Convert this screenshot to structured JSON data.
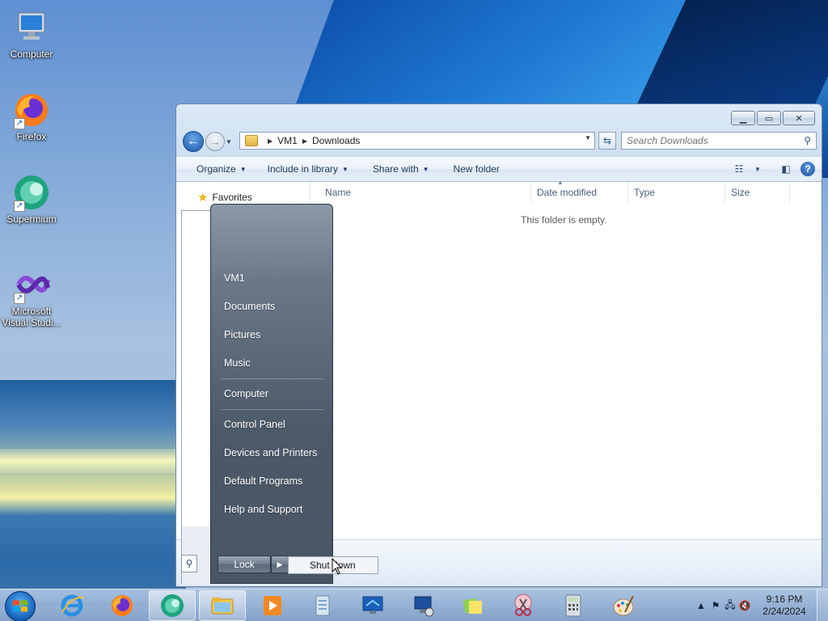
{
  "desktop": {
    "icons": [
      {
        "label": "Computer"
      },
      {
        "label": "Firefox"
      },
      {
        "label": "Supermium"
      },
      {
        "label": "Microsoft Visual Studi..."
      }
    ]
  },
  "explorer": {
    "address": {
      "root": "VM1",
      "current": "Downloads"
    },
    "search_placeholder": "Search Downloads",
    "toolbar": {
      "organize": "Organize",
      "include": "Include in library",
      "share": "Share with",
      "new_folder": "New folder"
    },
    "nav": {
      "favorites": "Favorites"
    },
    "columns": [
      "Name",
      "Date modified",
      "Type",
      "Size"
    ],
    "empty_message": "This folder is empty."
  },
  "start_menu": {
    "items": [
      "VM1",
      "Documents",
      "Pictures",
      "Music",
      "Computer",
      "Control Panel",
      "Devices and Printers",
      "Default Programs",
      "Help and Support"
    ],
    "lock": "Lock",
    "shutdown": "Shut down"
  },
  "taskbar": {
    "time": "9:16 PM",
    "date": "2/24/2024"
  }
}
